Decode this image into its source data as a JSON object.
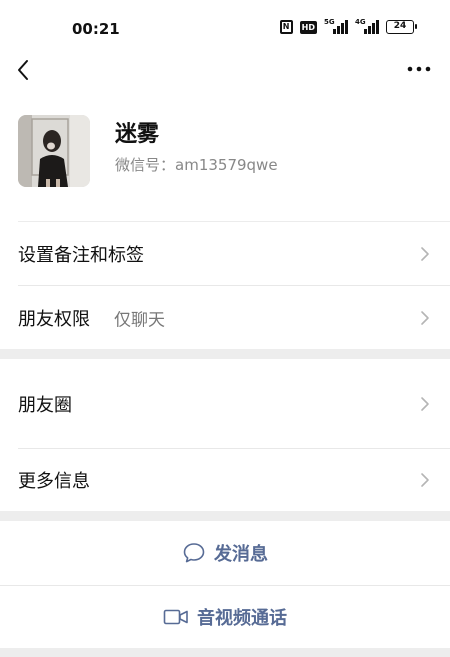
{
  "status_bar": {
    "time": "00:21",
    "nfc": "N",
    "hd": "HD",
    "signal1_tag": "5G",
    "signal2_tag": "4G",
    "battery": "24"
  },
  "nav": {
    "back_icon": "chevron-left-icon",
    "more_icon": "more-horizontal-icon"
  },
  "profile": {
    "name": "迷雾",
    "wechat_id_label": "微信号：",
    "wechat_id": "am13579qwe"
  },
  "settings": {
    "remark_label": "设置备注和标签",
    "permission_label": "朋友权限",
    "permission_value": "仅聊天"
  },
  "info": {
    "moments_label": "朋友圈",
    "more_info_label": "更多信息"
  },
  "actions": {
    "message_label": "发消息",
    "call_label": "音视频通话"
  },
  "colors": {
    "link_blue": "#576b95",
    "background": "#ededed",
    "card": "#ffffff"
  }
}
